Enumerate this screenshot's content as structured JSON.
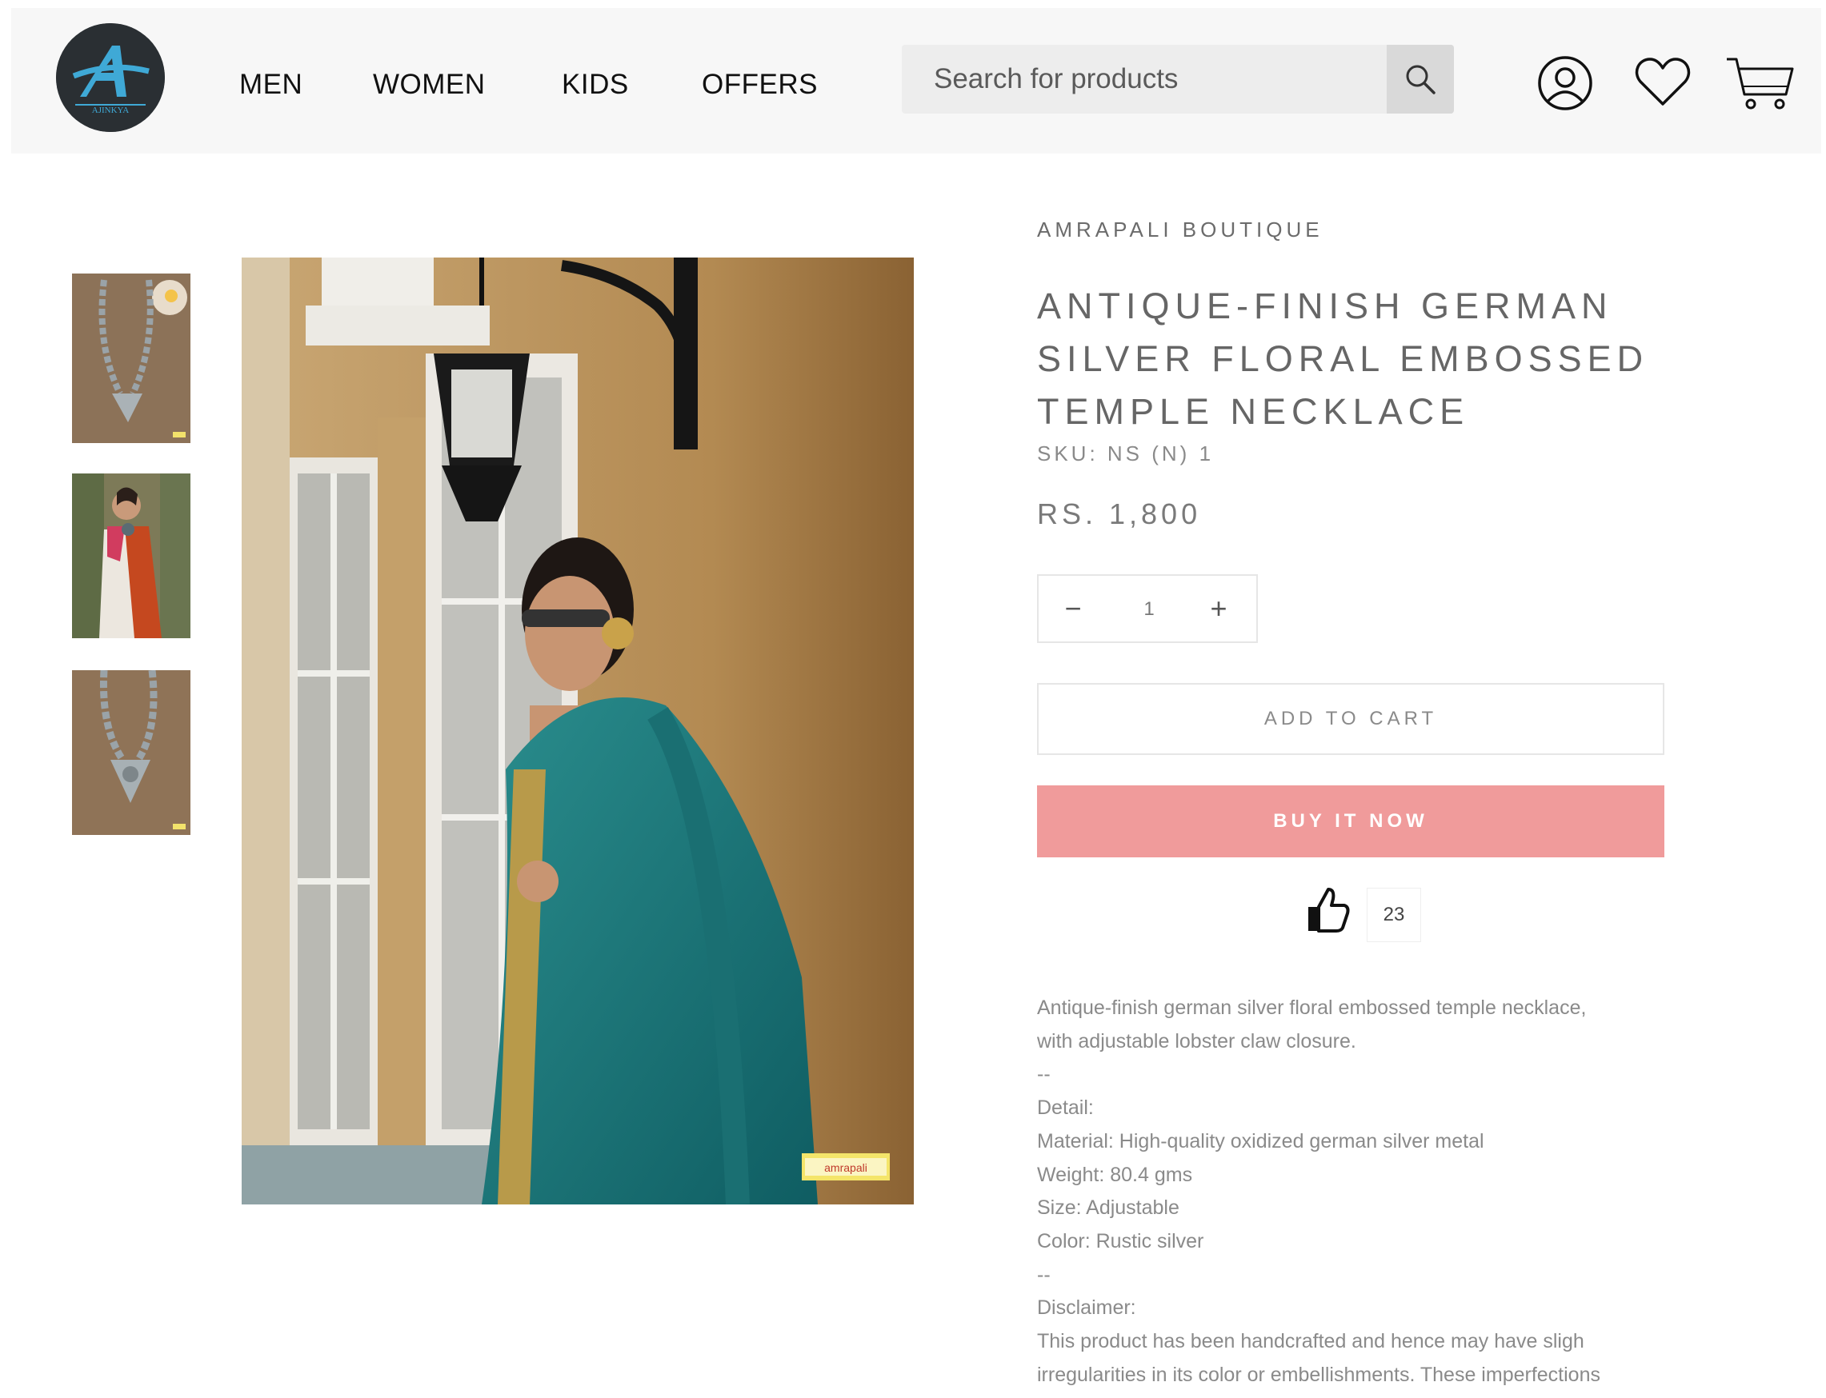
{
  "header": {
    "logo_text": "AJINKYA",
    "nav": [
      "MEN",
      "WOMEN",
      "KIDS",
      "OFFERS"
    ],
    "search": {
      "placeholder": "Search for products",
      "value": ""
    },
    "icons": [
      "search-icon",
      "account-icon",
      "wishlist-heart-icon",
      "cart-icon"
    ]
  },
  "gallery": {
    "thumbnails": [
      "necklace-flatlay",
      "model-in-red-saree",
      "necklace-closeup"
    ],
    "main_image": "model-in-teal-saree-wearing-necklace",
    "watermark": "amrapali"
  },
  "product": {
    "brand": "AMRAPALI BOUTIQUE",
    "title_lines": [
      "ANTIQUE-FINISH GERMAN",
      "SILVER FLORAL EMBOSSED",
      "TEMPLE NECKLACE"
    ],
    "sku": "SKU: NS (N) 1",
    "price": "RS. 1,800",
    "quantity": "1",
    "qty_minus": "−",
    "qty_plus": "+",
    "add_to_cart": "ADD TO CART",
    "buy_now": "BUY IT NOW",
    "likes": "23",
    "description_lines": [
      "Antique-finish german silver floral embossed temple necklace,",
      "with adjustable lobster claw closure.",
      "--",
      "Detail:",
      "Material: High-quality oxidized german silver metal",
      "Weight: 80.4 gms",
      "Size: Adjustable",
      "Color: Rustic silver",
      "--",
      "Disclaimer:",
      "This product has been handcrafted and hence may have sligh",
      "irregularities in its color or embellishments. These imperfections"
    ]
  },
  "colors": {
    "header_bg": "#f7f7f7",
    "buy_now_bg": "#f09b9b",
    "logo_bg": "#2a2f33",
    "logo_accent": "#3fa9d6"
  }
}
